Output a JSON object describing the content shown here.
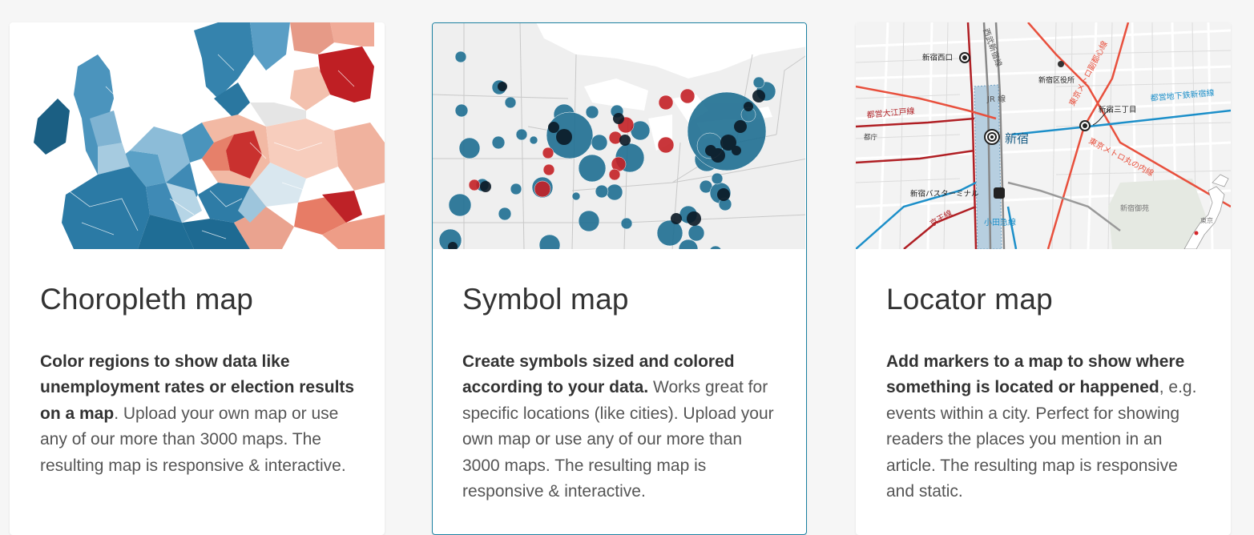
{
  "cards": [
    {
      "title": "Choropleth map",
      "desc_bold": "Color regions to show data like unemployment rates or election results on a map",
      "desc_rest": ". Upload your own map or use any of our more than 3000 maps. The resulting map is responsive & interactive.",
      "thumbnail_icon": "choropleth-europe-thumbnail"
    },
    {
      "title": "Symbol map",
      "desc_bold": "Create symbols sized and colored according to your data.",
      "desc_rest": " Works great for specific locations (like cities). Upload your own map or use any of our more than 3000 maps. The resulting map is responsive & interactive.",
      "thumbnail_icon": "symbol-usa-thumbnail",
      "selected": true
    },
    {
      "title": "Locator map",
      "desc_bold": "Add markers to a map to show where something is located or happened",
      "desc_rest": ", e.g. events within a city. Perfect for showing readers the places you mention in an article. The resulting map is responsive and static.",
      "thumbnail_icon": "locator-tokyo-thumbnail"
    }
  ],
  "locator_labels": {
    "station_west": "新宿西口",
    "line_seibu": "西武新宿線",
    "ward_office": "新宿区役所",
    "metro_marunouchi_top": "東京メトロ副都心線",
    "line_oedo": "都営大江戸線",
    "jr_line": "JR 線",
    "station_sanchome": "新宿三丁目",
    "line_shinjuku_subway": "都営地下鉄新宿線",
    "tocho": "都庁",
    "main_station": "新宿",
    "metro_marunouchi": "東京メトロ丸の内線",
    "bus_terminal": "新宿バスターミナル",
    "line_keio": "京王線",
    "line_odakyu": "小田急線",
    "gyoen": "新宿御苑",
    "tokyo": "東京"
  },
  "colors": {
    "blue_dark": "#1a6a8f",
    "blue_mid": "#4a98c0",
    "blue_light": "#a9cde0",
    "red_dark": "#b51f24",
    "red_mid": "#e3705e",
    "red_light": "#f6c5b4",
    "neutral": "#dcdcdc",
    "accent_border": "#1d81a2"
  }
}
